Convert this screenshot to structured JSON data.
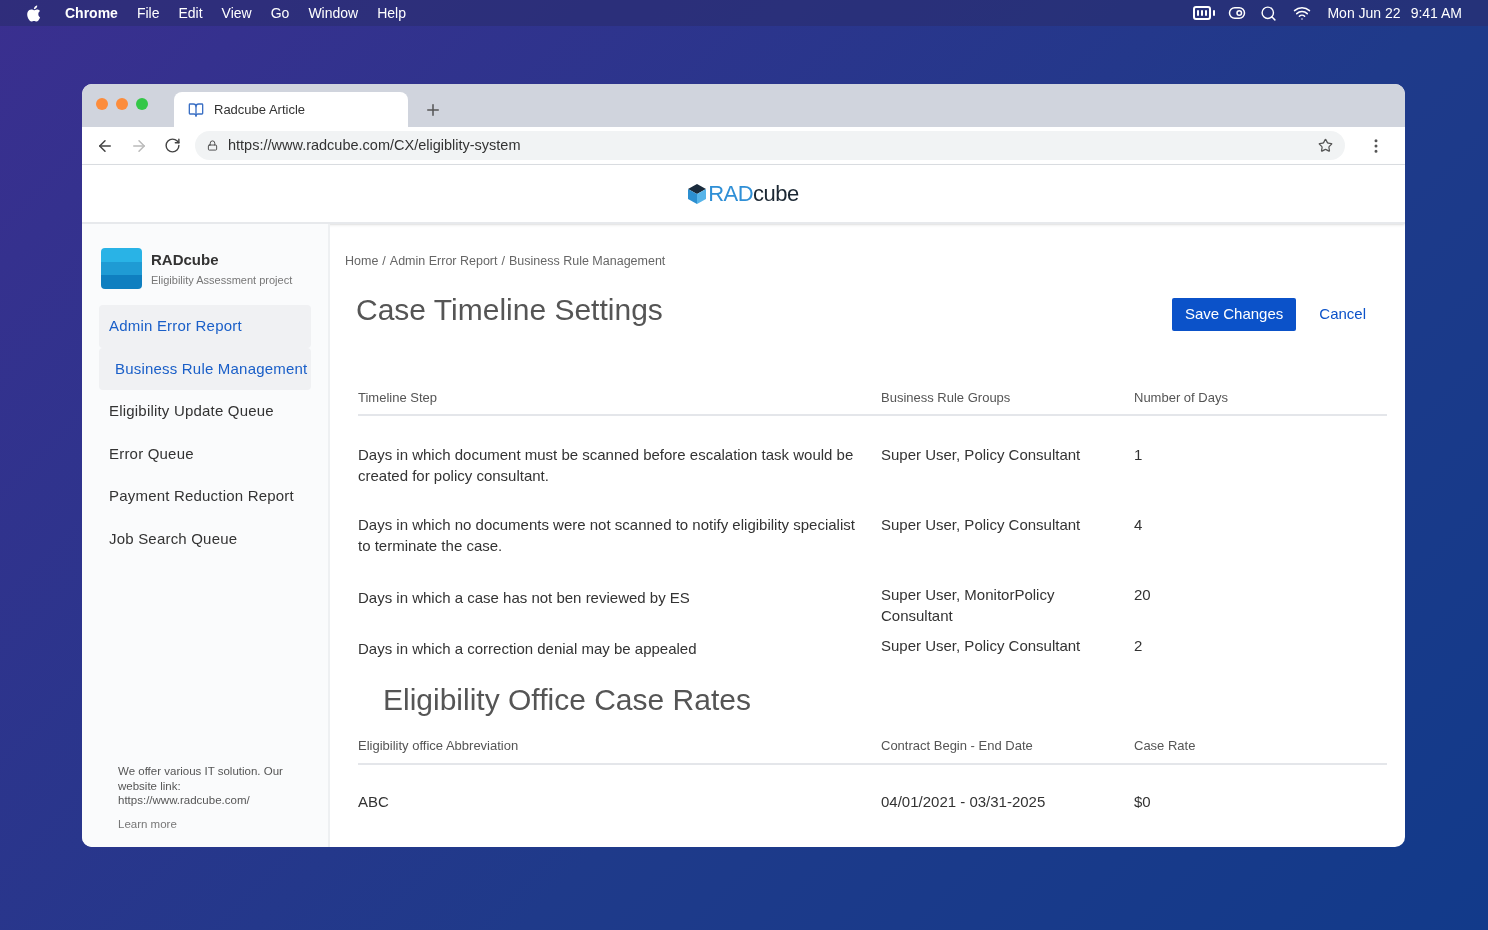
{
  "menu_bar": {
    "app": "Chrome",
    "menus": [
      "File",
      "Edit",
      "View",
      "Go",
      "Window",
      "Help"
    ],
    "date": "Mon Jun 22",
    "time": "9:41 AM"
  },
  "browser": {
    "tab": {
      "title": "Radcube Article"
    },
    "url": "https://www.radcube.com/CX/eligiblity-system"
  },
  "site_logo": {
    "part_1": "RAD",
    "part_2": "cube"
  },
  "sidebar": {
    "project": {
      "name": "RADcube",
      "subtitle": "Eligibility Assessment project"
    },
    "items": [
      {
        "label": "Admin Error Report",
        "selected": true,
        "children": [
          {
            "label": "Business Rule Management",
            "selected": true
          }
        ]
      },
      {
        "label": "Eligibility Update Queue",
        "selected": false
      },
      {
        "label": "Error Queue",
        "selected": false
      },
      {
        "label": "Payment Reduction Report",
        "selected": false
      },
      {
        "label": "Job Search Queue",
        "selected": false
      }
    ],
    "footer": {
      "text": "We offer various IT solution. Our website link: https://www.radcube.com/",
      "link": "Learn more"
    }
  },
  "breadcrumb": {
    "separator": "/",
    "items": [
      "Home",
      "Admin Error Report",
      "Business Rule Management"
    ]
  },
  "page_title": "Case Timeline Settings",
  "buttons": {
    "save": "Save Changes",
    "cancel": "Cancel"
  },
  "timeline_table": {
    "columns": [
      "Timeline Step",
      "Business Rule Groups",
      "Number of Days"
    ],
    "rows": [
      [
        "Days in which document must be scanned before escalation task would be created for policy consultant.",
        "Super User, Policy Consultant",
        "1"
      ],
      [
        "Days in which no documents were not scanned to notify eligibility specialist to terminate the case.",
        "Super User, Policy Consultant",
        "4"
      ],
      [
        "Days in which a case has not ben reviewed by ES",
        "Super User, MonitorPolicy Consultant",
        "20"
      ],
      [
        "Days in which a correction denial may be appealed",
        "Super User, Policy Consultant",
        "2"
      ]
    ]
  },
  "rates_title": "Eligibility Office Case Rates",
  "rates_table": {
    "columns": [
      "Eligibility office Abbreviation",
      "Contract Begin - End Date",
      "Case Rate"
    ],
    "rows": [
      [
        "ABC",
        "04/01/2021 - 03/31-2025",
        "$0"
      ]
    ]
  }
}
